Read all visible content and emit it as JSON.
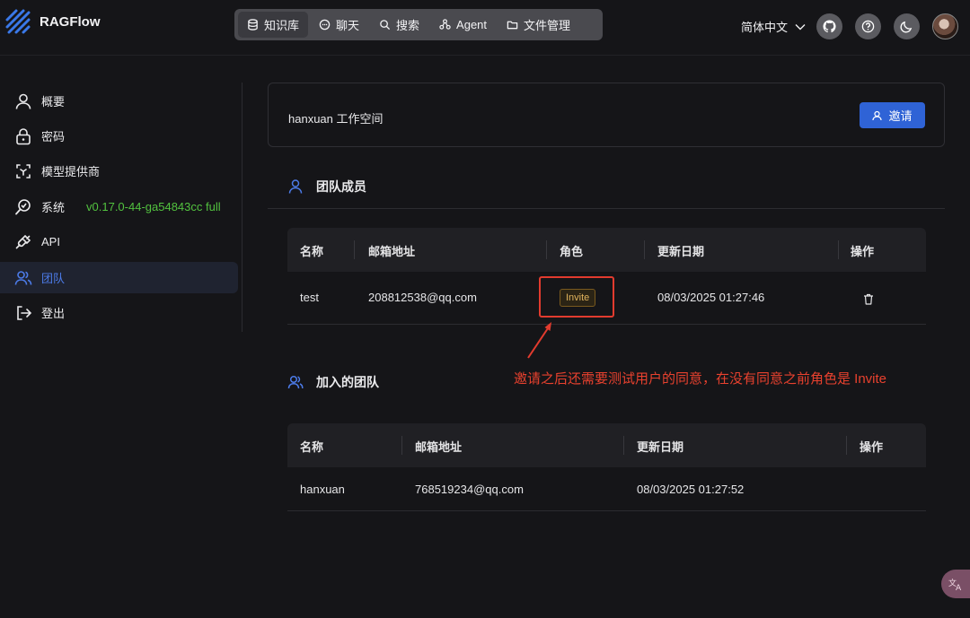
{
  "app": {
    "name": "RAGFlow"
  },
  "nav": {
    "items": [
      {
        "label": "知识库",
        "icon": "database-icon",
        "active": true
      },
      {
        "label": "聊天",
        "icon": "chat-icon",
        "active": false
      },
      {
        "label": "搜索",
        "icon": "search-icon",
        "active": false
      },
      {
        "label": "Agent",
        "icon": "agent-icon",
        "active": false
      },
      {
        "label": "文件管理",
        "icon": "folder-icon",
        "active": false
      }
    ]
  },
  "header": {
    "language": "简体中文"
  },
  "sidebar": {
    "items": [
      {
        "label": "概要",
        "icon": "user-icon"
      },
      {
        "label": "密码",
        "icon": "lock-icon"
      },
      {
        "label": "模型提供商",
        "icon": "model-icon"
      },
      {
        "label": "系统",
        "icon": "system-icon",
        "extra": "v0.17.0-44-ga54843cc full"
      },
      {
        "label": "API",
        "icon": "plug-icon"
      },
      {
        "label": "团队",
        "icon": "team-icon",
        "active": true
      },
      {
        "label": "登出",
        "icon": "logout-icon"
      }
    ]
  },
  "workspace": {
    "title": "hanxuan 工作空间",
    "invite_label": "邀请"
  },
  "members": {
    "title": "团队成员",
    "columns": [
      "名称",
      "邮箱地址",
      "角色",
      "更新日期",
      "操作"
    ],
    "rows": [
      {
        "name": "test",
        "email": "208812538@qq.com",
        "role": "Invite",
        "updated": "08/03/2025 01:27:46"
      }
    ]
  },
  "joined": {
    "title": "加入的团队",
    "columns": [
      "名称",
      "邮箱地址",
      "更新日期",
      "操作"
    ],
    "rows": [
      {
        "name": "hanxuan",
        "email": "768519234@qq.com",
        "updated": "08/03/2025 01:27:52"
      }
    ]
  },
  "annotation": {
    "text": "邀请之后还需要测试用户的同意，在没有同意之前角色是 Invite",
    "color": "#e8412e"
  },
  "colors": {
    "accent": "#2f63d6",
    "version": "#52c23f",
    "badge": "#e0b35c"
  }
}
